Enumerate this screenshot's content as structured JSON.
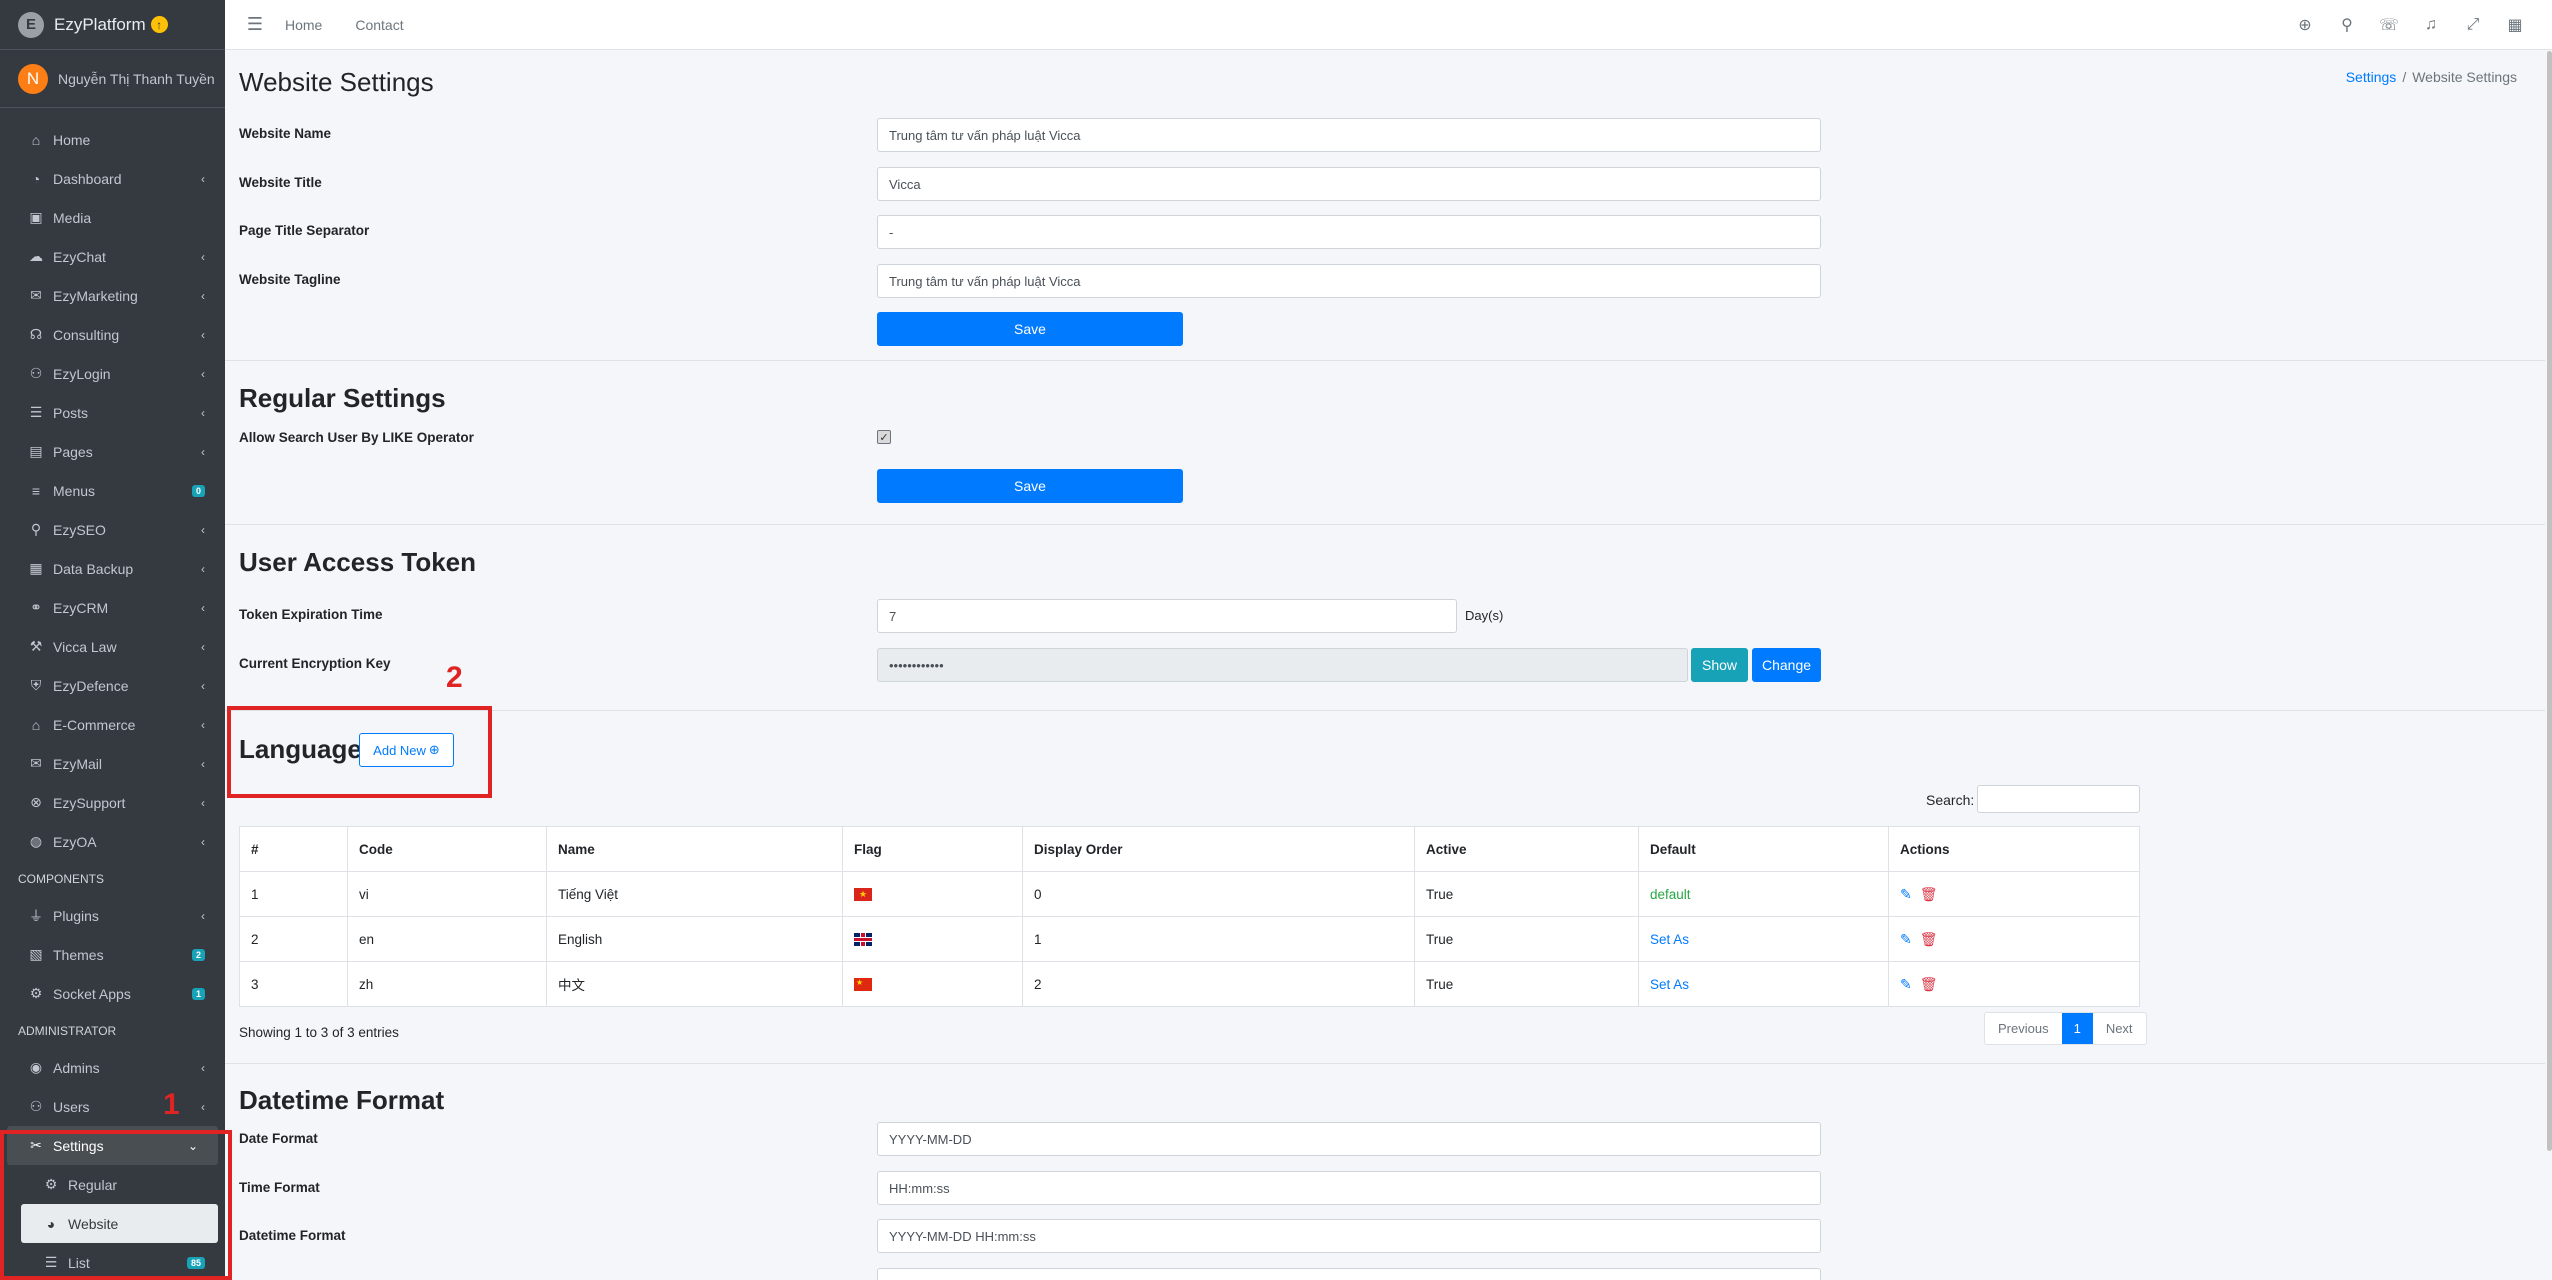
{
  "brand": {
    "name": "EzyPlatform",
    "logo_glyph": "E",
    "badge_glyph": "↑"
  },
  "user": {
    "initial": "N",
    "name": "Nguyễn Thị Thanh Tuyền"
  },
  "sidebar": {
    "items": [
      {
        "label": "Home",
        "icon": "⌂"
      },
      {
        "label": "Dashboard",
        "icon": "◔",
        "chevron": "‹"
      },
      {
        "label": "Media",
        "icon": "▣"
      },
      {
        "label": "EzyChat",
        "icon": "☁",
        "chevron": "‹"
      },
      {
        "label": "EzyMarketing",
        "icon": "✉",
        "chevron": "‹"
      },
      {
        "label": "Consulting",
        "icon": "☊",
        "chevron": "‹"
      },
      {
        "label": "EzyLogin",
        "icon": "⚇",
        "chevron": "‹"
      },
      {
        "label": "Posts",
        "icon": "☰",
        "chevron": "‹"
      },
      {
        "label": "Pages",
        "icon": "▤",
        "chevron": "‹"
      },
      {
        "label": "Menus",
        "icon": "≡",
        "badge": "0"
      },
      {
        "label": "EzySEO",
        "icon": "⚲",
        "chevron": "‹"
      },
      {
        "label": "Data Backup",
        "icon": "▦",
        "chevron": "‹"
      },
      {
        "label": "EzyCRM",
        "icon": "⚭",
        "chevron": "‹"
      },
      {
        "label": "Vicca Law",
        "icon": "⚒",
        "chevron": "‹"
      },
      {
        "label": "EzyDefence",
        "icon": "⛨",
        "chevron": "‹"
      },
      {
        "label": "E-Commerce",
        "icon": "⌂",
        "chevron": "‹"
      },
      {
        "label": "EzyMail",
        "icon": "✉",
        "chevron": "‹"
      },
      {
        "label": "EzySupport",
        "icon": "⊗",
        "chevron": "‹"
      },
      {
        "label": "EzyOA",
        "icon": "◍",
        "chevron": "‹"
      }
    ],
    "components_header": "COMPONENTS",
    "components": [
      {
        "label": "Plugins",
        "icon": "⏚",
        "chevron": "‹"
      },
      {
        "label": "Themes",
        "icon": "▧",
        "badge": "2"
      },
      {
        "label": "Socket Apps",
        "icon": "⚙",
        "badge": "1"
      }
    ],
    "admin_header": "ADMINISTRATOR",
    "admin": [
      {
        "label": "Admins",
        "icon": "◉",
        "chevron": "‹"
      },
      {
        "label": "Users",
        "icon": "⚇",
        "chevron": "‹"
      }
    ],
    "settings": {
      "label": "Settings",
      "icon": "✂",
      "chevron": "⌄"
    },
    "settings_children": [
      {
        "label": "Regular",
        "icon": "⚙"
      },
      {
        "label": "Website",
        "icon": "◕"
      },
      {
        "label": "List",
        "icon": "☰",
        "badge": "85"
      }
    ]
  },
  "topbar": {
    "menu_icon": "☰",
    "links": [
      "Home",
      "Contact"
    ],
    "icons": [
      "⊕",
      "⚲",
      "☏",
      "♫",
      "⤢",
      "▦"
    ]
  },
  "annotations": {
    "one": "1",
    "two": "2"
  },
  "page": {
    "title": "Website Settings"
  },
  "breadcrumb": {
    "parent": "Settings",
    "separator": "/",
    "current": "Website Settings"
  },
  "website_settings": {
    "name_label": "Website Name",
    "name_value": "Trung tâm tư vấn pháp luật Vicca",
    "title_label": "Website Title",
    "title_value": "Vicca",
    "separator_label": "Page Title Separator",
    "separator_value": "-",
    "tagline_label": "Website Tagline",
    "tagline_value": "Trung tâm tư vấn pháp luật Vicca",
    "save": "Save"
  },
  "regular_settings": {
    "title": "Regular Settings",
    "like_label": "Allow Search User By LIKE Operator",
    "like_check": "✓",
    "save": "Save"
  },
  "token": {
    "title": "User Access Token",
    "expiration_label": "Token Expiration Time",
    "expiration_value": "7",
    "suffix": "Day(s)",
    "key_label": "Current Encryption Key",
    "key_value": "••••••••••••",
    "show": "Show",
    "change": "Change"
  },
  "languages": {
    "title": "Languages",
    "add_new": "Add New",
    "add_icon": "⊕",
    "search_label": "Search:",
    "columns": [
      "#",
      "Code",
      "Name",
      "Flag",
      "Display Order",
      "Active",
      "Default",
      "Actions"
    ],
    "rows": [
      {
        "num": "1",
        "code": "vi",
        "name": "Tiếng Việt",
        "flag": "vi",
        "order": "0",
        "active": "True",
        "default": "default"
      },
      {
        "num": "2",
        "code": "en",
        "name": "English",
        "flag": "en",
        "order": "1",
        "active": "True",
        "default": "Set As"
      },
      {
        "num": "3",
        "code": "zh",
        "name": "中文",
        "flag": "zh",
        "order": "2",
        "active": "True",
        "default": "Set As"
      }
    ],
    "edit_icon": "✎",
    "delete_icon": "🗑",
    "showing": "Showing 1 to 3 of 3 entries",
    "pager": {
      "previous": "Previous",
      "current": "1",
      "next": "Next"
    }
  },
  "datetime": {
    "title": "Datetime Format",
    "date_label": "Date Format",
    "date_value": "YYYY-MM-DD",
    "time_label": "Time Format",
    "time_value": "HH:mm:ss",
    "datetime_label": "Datetime Format",
    "datetime_value": "YYYY-MM-DD HH:mm:ss"
  },
  "colors": {
    "primary": "#007bff",
    "info": "#17a2b8",
    "sidebar": "#343a40",
    "annotation": "#e02424",
    "success": "#28a745",
    "danger": "#dc3545"
  }
}
